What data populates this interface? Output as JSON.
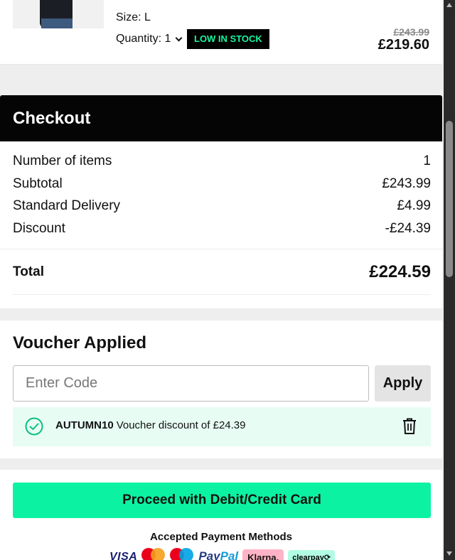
{
  "product": {
    "size_text": "Size: L",
    "quantity_text": "Quantity: 1",
    "stock_badge": "LOW IN STOCK",
    "original_price": "£243.99",
    "sale_price": "£219.60"
  },
  "checkout": {
    "title": "Checkout",
    "rows": [
      {
        "label": "Number of items",
        "value": "1"
      },
      {
        "label": "Subtotal",
        "value": "£243.99"
      },
      {
        "label": "Standard Delivery",
        "value": "£4.99"
      },
      {
        "label": "Discount",
        "value": "-£24.39"
      }
    ],
    "total_label": "Total",
    "total_value": "£224.59"
  },
  "voucher": {
    "title": "Voucher Applied",
    "input_placeholder": "Enter Code",
    "input_value": "",
    "apply_label": "Apply",
    "applied_code": "AUTUMN10",
    "applied_description": "Voucher discount of £24.39"
  },
  "payment": {
    "proceed_label": "Proceed with Debit/Credit Card",
    "methods_title": "Accepted Payment Methods",
    "methods": {
      "visa": "VISA",
      "paypal_a": "Pay",
      "paypal_b": "Pal",
      "klarna": "Klarna.",
      "clearpay": "clearpay⟳"
    }
  },
  "colors": {
    "accent": "#0bf3a2",
    "stock_badge_text": "#19f5a0",
    "header_bg": "#050505",
    "applied_bg": "#e7fdf4"
  },
  "icons": {
    "quantity": "chevron-down-icon",
    "voucher_check": "check-circle-icon",
    "voucher_remove": "trash-icon"
  }
}
